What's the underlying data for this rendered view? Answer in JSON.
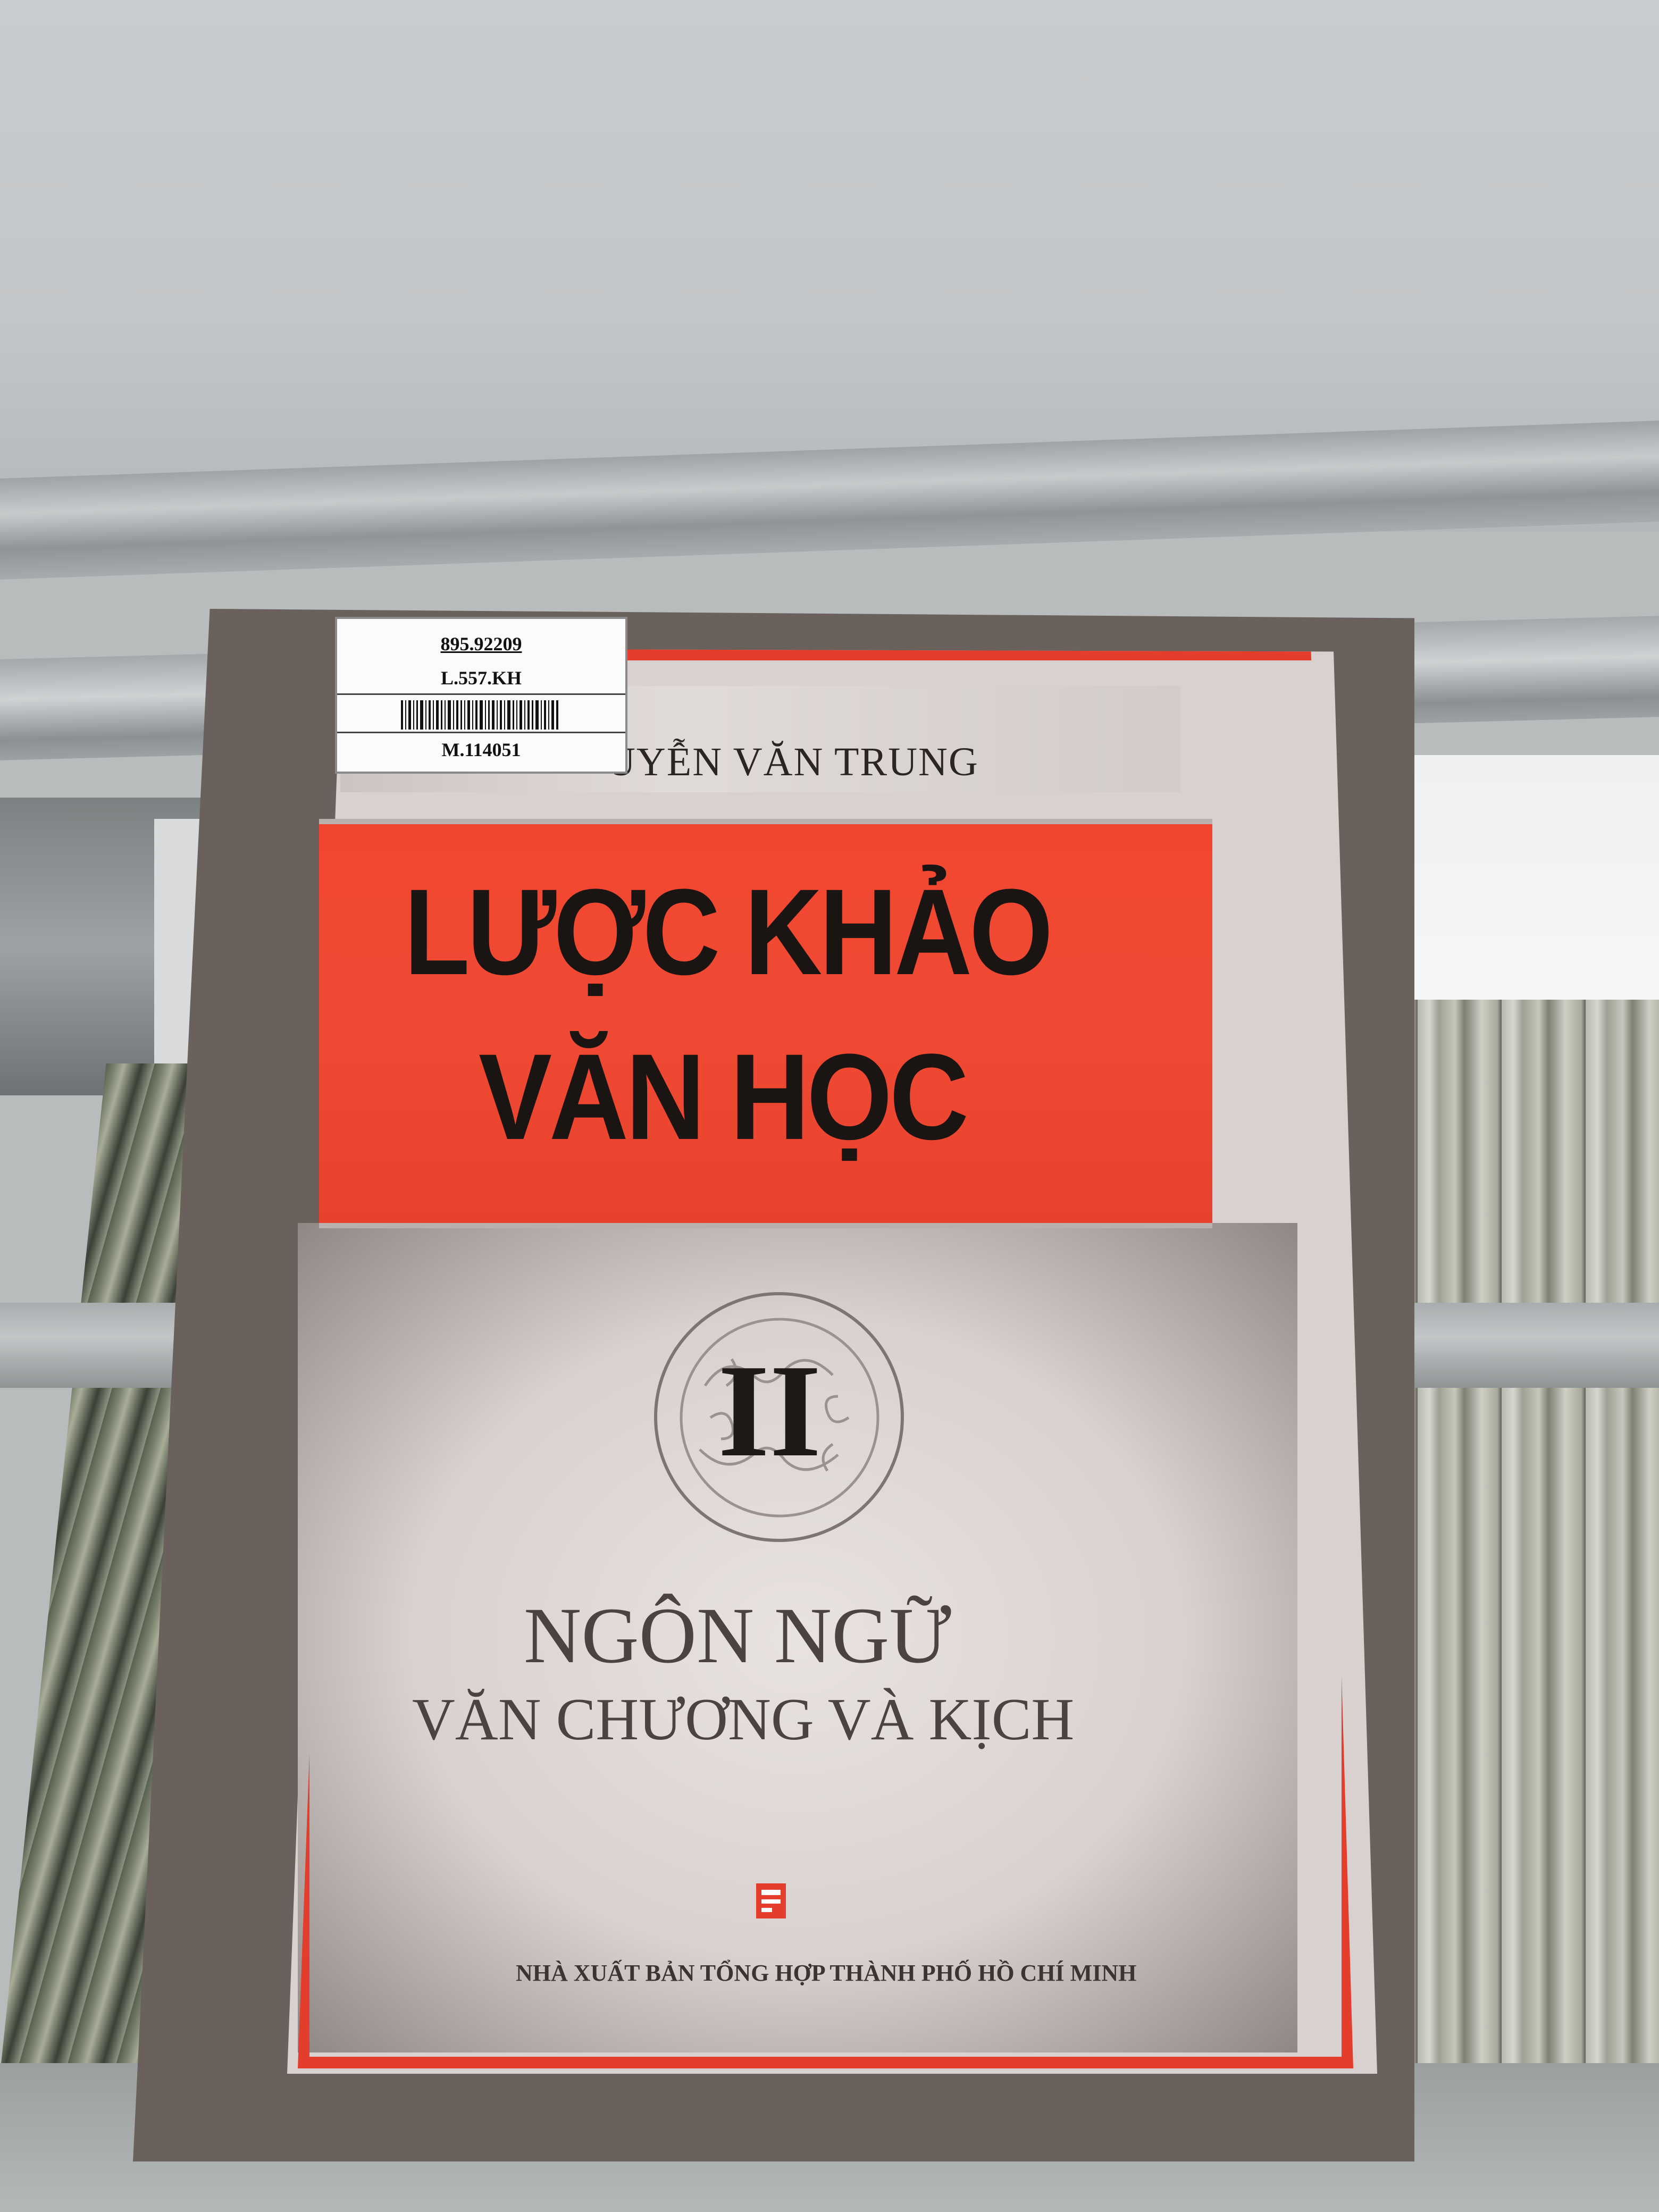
{
  "label": {
    "call_number_line1": "895.92209",
    "call_number_line2": "L.557.KH",
    "accession": "M.114051"
  },
  "cover": {
    "author": "UYỄN VĂN TRUNG",
    "title_line1": "LƯỢC KHẢO",
    "title_line2": "VĂN HỌC",
    "volume": "II",
    "subtitle_line1": "NGÔN NGỮ",
    "subtitle_line2": "VĂN CHƯƠNG VÀ KỊCH",
    "publisher": "NHÀ XUẤT BẢN TỔNG HỢP THÀNH PHỐ HỒ CHÍ MINH"
  },
  "colors": {
    "accent_red": "#e53d2b",
    "cover_background": "#d8d1cf",
    "title_text": "#1a1512"
  }
}
